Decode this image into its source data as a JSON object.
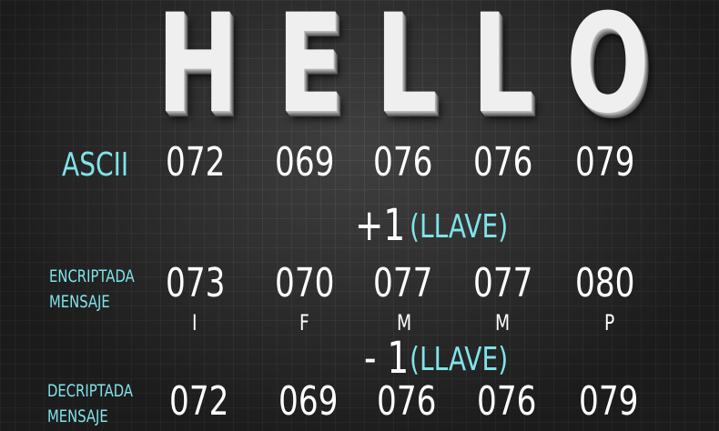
{
  "title_letters": [
    "H",
    "E",
    "L",
    "L",
    "O"
  ],
  "ascii": {
    "label": "ASCII",
    "values": [
      "072",
      "069",
      "076",
      "076",
      "079"
    ]
  },
  "encrypt_key": {
    "value": "+1",
    "label": "(LLAVE)"
  },
  "encrypted": {
    "label_line1": "ENCRIPTADA",
    "label_line2": "MENSAJE",
    "values": [
      "073",
      "070",
      "077",
      "077",
      "080"
    ],
    "chars": [
      "I",
      "F",
      "M",
      "M",
      "P"
    ]
  },
  "decrypt_key": {
    "value": "- 1",
    "label": "(LLAVE)"
  },
  "decrypted": {
    "label_line1": "DECRIPTADA",
    "label_line2": "MENSAJE",
    "values": [
      "072",
      "069",
      "076",
      "076",
      "079"
    ]
  },
  "colors": {
    "accent": "#7fe3ea",
    "text": "#ffffff",
    "background": "#2a2a2a"
  }
}
